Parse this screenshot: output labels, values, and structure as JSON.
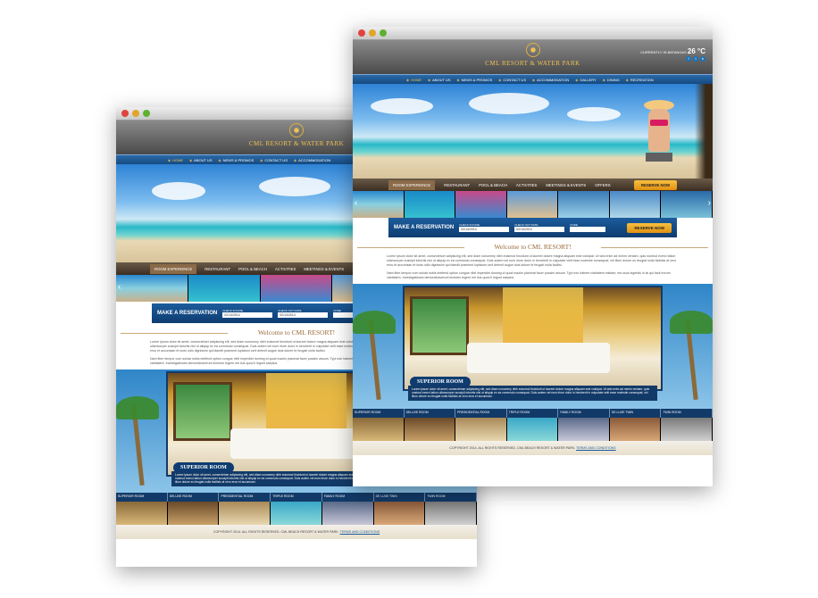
{
  "site": {
    "name": "CML RESORT & WATER PARK",
    "weather_label": "CURRENTLY IN BATANGAS",
    "temperature": "26 °C",
    "social": [
      "f",
      "t",
      "b"
    ]
  },
  "nav": [
    "HOME",
    "ABOUT US",
    "NEWS & PROMOS",
    "CONTACT US",
    "ACCOMMODATION",
    "GALLERY",
    "DINING",
    "RECREATION"
  ],
  "tabs": [
    "ROOM EXPERIENCE",
    "RESTAURANT",
    "POOL & BEACH",
    "ACTIVITIES",
    "MEETINGS & EVENTS",
    "OFFERS"
  ],
  "reserve_now": "RESERVE NOW",
  "reservation": {
    "title": "MAKE A RESERVATION",
    "checkin_label": "CHECK IN DATE",
    "checkin_value": "02/14/2014",
    "checkout_label": "CHECK OUT DATE",
    "checkout_value": "02/14/2014",
    "code_label": "CODE",
    "button": "RESERVE NOW"
  },
  "welcome": {
    "title": "Welcome to CML RESORT!",
    "p1": "Lorem ipsum dolor sit amet, consectetuer adipiscing elit, sed diam nonummy nibh euismod tincidunt ut laoreet dolore magna aliquam erat volutpat. Ut wisi enim ad minim veniam, quis nostrud exerci tation ullamcorper suscipit lobortis nisl ut aliquip ex ea commodo consequat. Duis autem vel eum iriure dolor in hendrerit in vulputate velit esse molestie consequat, vel illum dolore eu feugiat nulla facilisis at vero eros et accumsan et iusto odio dignissim qui blandit praesent luptatum zzril delenit augue duis dolore te feugait nulla facilisi.",
    "p2": "Nam liber tempor cum soluta nobis eleifend option congue nihil imperdiet doming id quod mazim placerat facer possim assum. Typi non habent claritatem insitam; est usus legentis in iis qui facit eorum claritatem. Investigationes demonstraverunt lectores legere me lius quod ii legunt saepius."
  },
  "featured_room": {
    "label": "SUPERIOR ROOM",
    "text": "Lorem ipsum dolor sit amet, consectetuer adipiscing elit, sed diam nonummy nibh euismod tincidunt ut laoreet dolore magna aliquam erat volutpat. Ut wisi enim ad minim veniam, quis nostrud exerci tation ullamcorper suscipit lobortis nisl ut aliquip ex ea commodo consequat. Duis autem vel eum iriure dolor in hendrerit in vulputate velit esse molestie consequat, vel illum dolore eu feugiat nulla facilisis at vero eros et accumsan."
  },
  "rooms": [
    "SUPERIOR ROOM",
    "DELUXE ROOM",
    "PRESIDENTIAL ROOM",
    "TRIPLE ROOM",
    "FAMILY ROOM",
    "DE LUXE TWIN",
    "TWIN ROOM"
  ],
  "footer": {
    "copyright": "COPYRIGHT 2014. ALL RIGHTS RESERVED. CML BEACH RESORT & WATER PARK.",
    "terms": "TERMS AND CONDITIONS"
  },
  "colors": {
    "brand_gold": "#f0c050",
    "nav_blue": "#1f5a96",
    "accent_orange": "#f0a020"
  }
}
